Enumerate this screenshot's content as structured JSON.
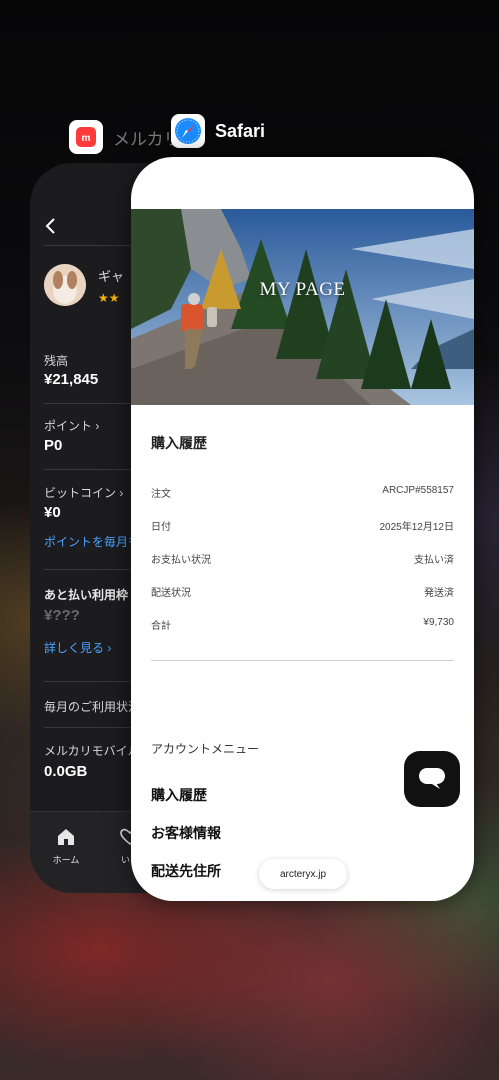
{
  "apps": {
    "mercari": {
      "name": "メルカリ",
      "back_icon": "chevron-left-icon",
      "profile": {
        "name_partial": "ギャ",
        "rating_stars": 2
      },
      "balance": {
        "label": "残高",
        "value": "¥21,845"
      },
      "points": {
        "label": "ポイント",
        "value": "P0"
      },
      "bitcoin": {
        "label": "ビットコイン",
        "value": "¥0",
        "link": "ポイントを毎月も"
      },
      "deferred": {
        "label": "あと払い利用枠",
        "value": "¥???",
        "link": "詳しく見る"
      },
      "monthly": {
        "label": "毎月のご利用状況"
      },
      "mobile": {
        "label": "メルカリモバイル",
        "value": "0.0GB"
      },
      "tabs": [
        {
          "label": "ホーム",
          "icon": "home-icon"
        },
        {
          "label": "いい",
          "icon": "heart-icon"
        }
      ]
    },
    "safari": {
      "name": "Safari",
      "hero_title": "MY PAGE",
      "section_title": "購入履歴",
      "details": [
        {
          "label": "注文",
          "value": "ARCJP#558157"
        },
        {
          "label": "日付",
          "value": "2025年12月12日"
        },
        {
          "label": "お支払い状況",
          "value": "支払い済"
        },
        {
          "label": "配送状況",
          "value": "発送済"
        },
        {
          "label": "合計",
          "value": "¥9,730"
        }
      ],
      "account_menu_label": "アカウントメニュー",
      "menu_links": [
        "購入履歴",
        "お客様情報",
        "配送先住所"
      ],
      "chat_icon": "chat-bubble-icon",
      "url": "arcteryx.jp"
    }
  },
  "colors": {
    "mercari_red": "#ff3a3a",
    "link_blue": "#4aa3ff",
    "safari_blue": "#1a8cff"
  }
}
